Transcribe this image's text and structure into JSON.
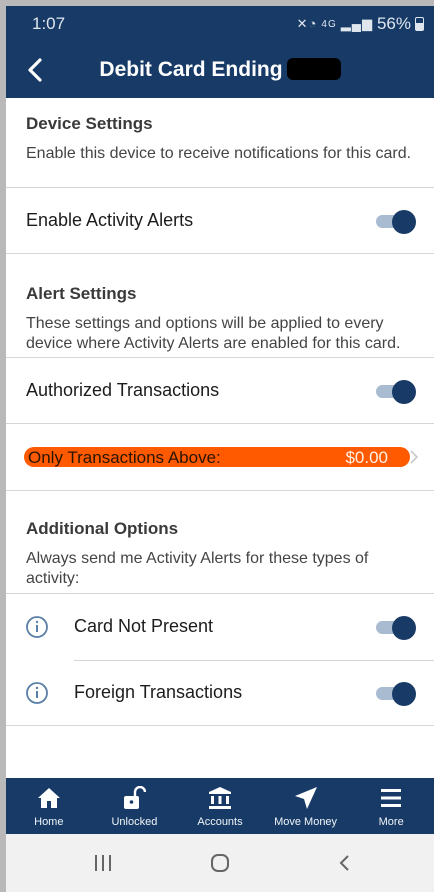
{
  "status_bar": {
    "time": "1:07",
    "network": "4G",
    "battery": "56%"
  },
  "header": {
    "title": "Debit Card Ending"
  },
  "device_settings": {
    "title": "Device Settings",
    "description": "Enable this device to receive notifications for this card."
  },
  "enable_activity_alerts": {
    "label": "Enable Activity Alerts",
    "on": true
  },
  "alert_settings": {
    "title": "Alert Settings",
    "description": "These settings and options will be applied to every device where Activity Alerts are enabled for this card."
  },
  "authorized_transactions": {
    "label": "Authorized Transactions",
    "on": true
  },
  "threshold": {
    "label": "Only Transactions Above:",
    "value": "$0.00"
  },
  "additional_options": {
    "title": "Additional Options",
    "description": "Always send me Activity Alerts for these types of activity:"
  },
  "card_not_present": {
    "label": "Card Not Present",
    "on": true
  },
  "foreign_transactions": {
    "label": "Foreign Transactions",
    "on": true
  },
  "bottom_nav": {
    "home": "Home",
    "unlocked": "Unlocked",
    "accounts": "Accounts",
    "move_money": "Move Money",
    "more": "More"
  },
  "colors": {
    "brand": "#173b66",
    "toggle_track": "#a8bbd0",
    "highlight": "#ff5a00"
  },
  "icons": [
    "chevron-left-icon",
    "info-icon",
    "home-icon",
    "unlocked-padlock-icon",
    "bank-icon",
    "paper-plane-icon",
    "hamburger-menu-icon",
    "recent-apps-icon",
    "home-circle-icon",
    "back-chevron-icon"
  ]
}
